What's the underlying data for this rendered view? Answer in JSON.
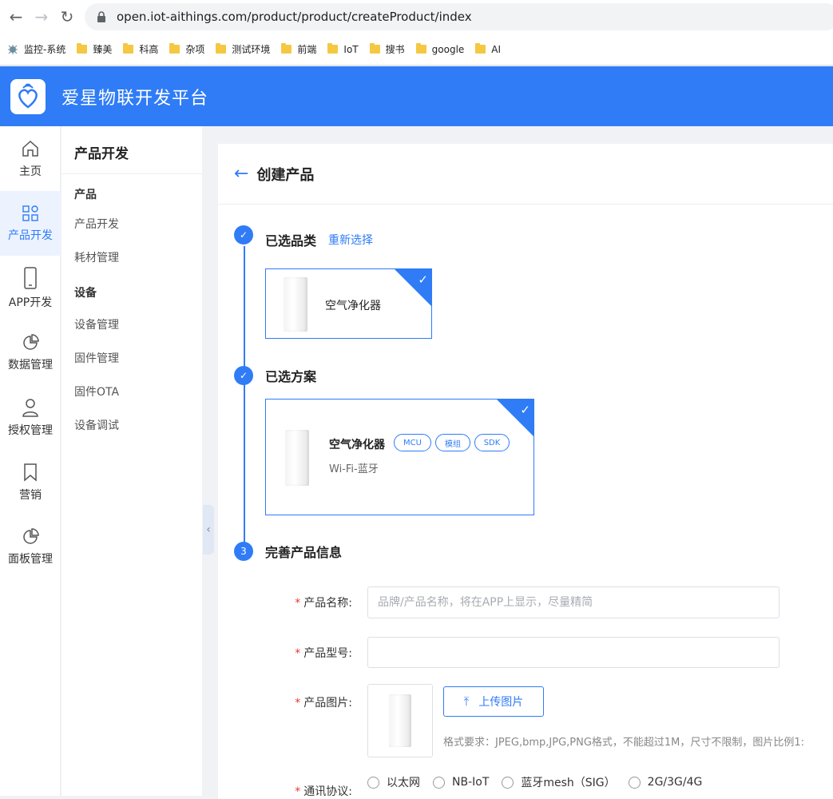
{
  "browser": {
    "url": "open.iot-aithings.com/product/product/createProduct/index",
    "bookmarks": [
      "监控-系统",
      "臻美",
      "科高",
      "杂项",
      "测试环境",
      "前端",
      "IoT",
      "搜书",
      "google",
      "AI"
    ]
  },
  "app": {
    "title": "爱星物联开发平台",
    "brand_color": "#2f7cf6"
  },
  "left_nav": [
    {
      "label": "主页",
      "icon": "home-icon"
    },
    {
      "label": "产品开发",
      "icon": "grid-icon",
      "active": true
    },
    {
      "label": "APP开发",
      "icon": "phone-icon"
    },
    {
      "label": "数据管理",
      "icon": "pie-chart-icon"
    },
    {
      "label": "授权管理",
      "icon": "user-icon"
    },
    {
      "label": "营销",
      "icon": "bookmark-icon"
    },
    {
      "label": "面板管理",
      "icon": "pie-chart-icon"
    }
  ],
  "sub_nav": {
    "title": "产品开发",
    "group1": "产品",
    "item_product_dev": "产品开发",
    "item_consumables": "耗材管理",
    "group2": "设备",
    "item_device_mgmt": "设备管理",
    "item_firmware": "固件管理",
    "item_ota": "固件OTA",
    "item_debug": "设备调试"
  },
  "page": {
    "title": "创建产品",
    "step1": {
      "label": "已选品类",
      "action": "重新选择",
      "category": "空气净化器"
    },
    "step2": {
      "label": "已选方案",
      "name": "空气净化器",
      "tags": [
        "MCU",
        "模组",
        "SDK"
      ],
      "connectivity": "Wi-Fi-蓝牙"
    },
    "step3": {
      "number": "3",
      "label": "完善产品信息"
    },
    "form": {
      "name_label": "产品名称",
      "name_placeholder": "品牌/产品名称，将在APP上显示，尽量精简",
      "model_label": "产品型号",
      "model_value": "",
      "image_label": "产品图片",
      "upload_label": "上传图片",
      "image_hint": "格式要求：JPEG,bmp,JPG,PNG格式，不能超过1M，尺寸不限制，图片比例1:",
      "comm_label": "通讯协议",
      "comm_options": [
        "以太网",
        "NB-IoT",
        "蓝牙mesh（SIG）",
        "2G/3G/4G"
      ]
    }
  }
}
